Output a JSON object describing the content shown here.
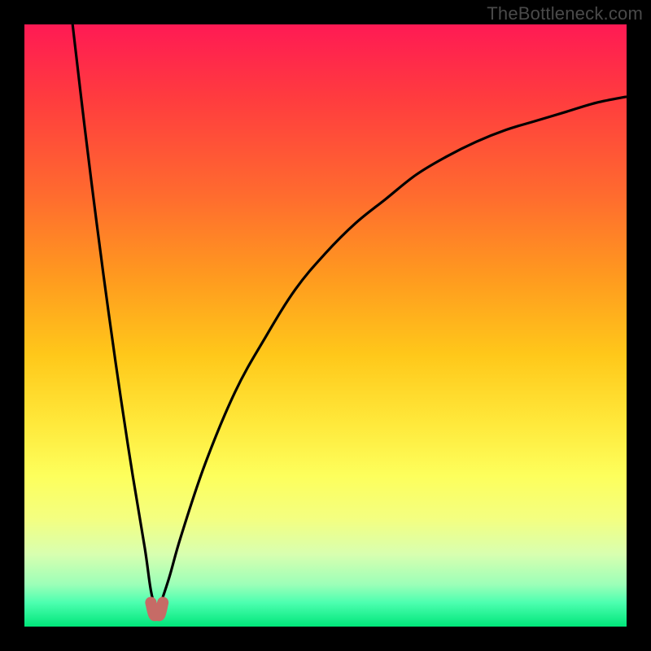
{
  "watermark": "TheBottleneck.com",
  "chart_data": {
    "type": "line",
    "title": "",
    "xlabel": "",
    "ylabel": "",
    "xlim": [
      0,
      100
    ],
    "ylim": [
      0,
      100
    ],
    "background_gradient": {
      "top": "#ff1a54",
      "bottom": "#00e67a",
      "meaning": "red = high bottleneck, green = low bottleneck"
    },
    "cusp_x": 22,
    "cusp_marker_color": "#c66b66",
    "series": [
      {
        "name": "left-branch",
        "x": [
          8,
          10,
          12,
          14,
          16,
          18,
          20,
          21,
          22
        ],
        "values": [
          100,
          83,
          67,
          52,
          38,
          25,
          13,
          6,
          2
        ]
      },
      {
        "name": "right-branch",
        "x": [
          22,
          24,
          26,
          30,
          35,
          40,
          45,
          50,
          55,
          60,
          65,
          70,
          75,
          80,
          85,
          90,
          95,
          100
        ],
        "values": [
          2,
          8,
          15,
          27,
          39,
          48,
          56,
          62,
          67,
          71,
          75,
          78,
          80.5,
          82.5,
          84,
          85.5,
          87,
          88
        ]
      },
      {
        "name": "cusp-marker",
        "x": [
          21,
          21.5,
          22,
          22.5,
          23
        ],
        "values": [
          4,
          2,
          2,
          2,
          4
        ]
      }
    ]
  }
}
